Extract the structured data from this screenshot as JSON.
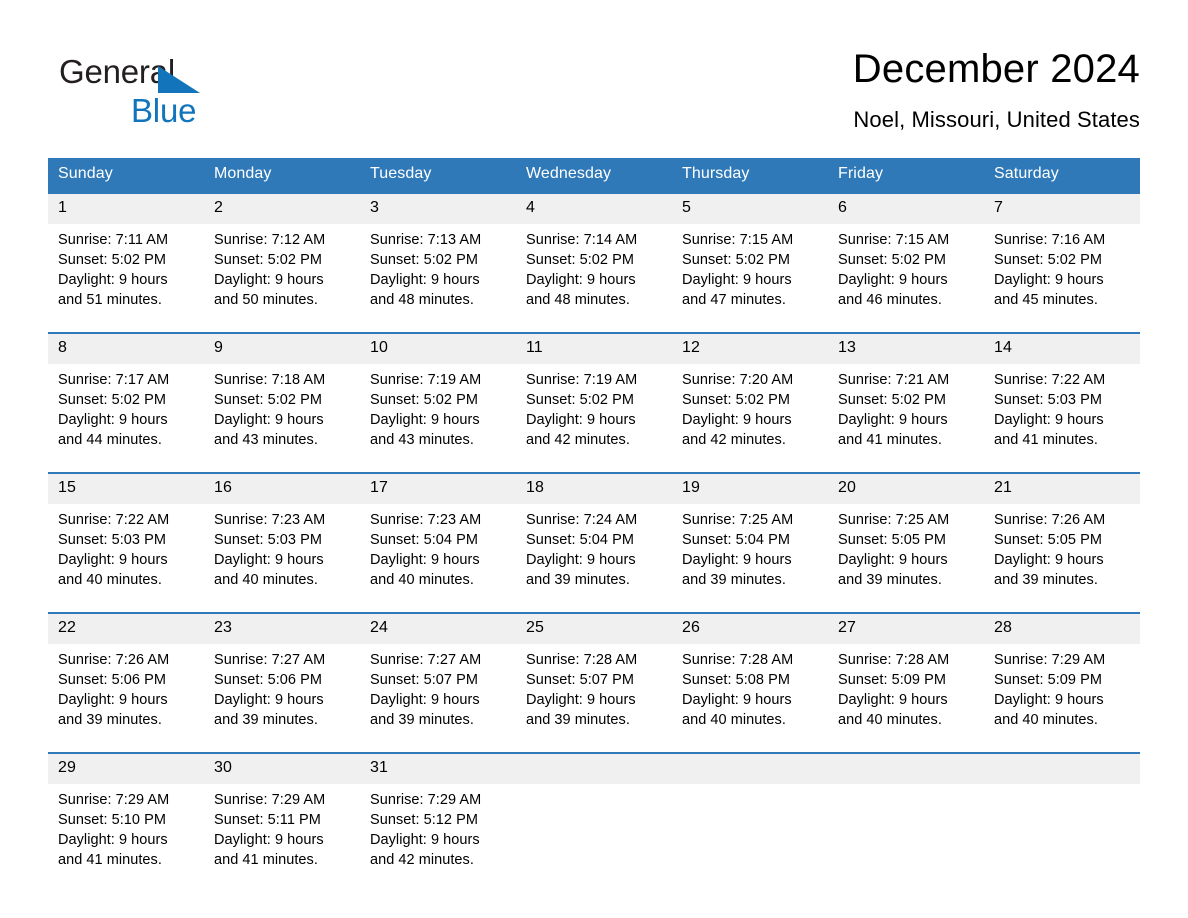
{
  "brand": {
    "name_part1": "General",
    "name_part2": "Blue",
    "accent_color": "#1275bc"
  },
  "header": {
    "title": "December 2024",
    "subtitle": "Noel, Missouri, United States"
  },
  "theme": {
    "header_blue": "#2f79b8",
    "daynum_band": "#f0f0f0",
    "cell_bg": "#ffffff"
  },
  "weekdays": [
    "Sunday",
    "Monday",
    "Tuesday",
    "Wednesday",
    "Thursday",
    "Friday",
    "Saturday"
  ],
  "weeks": [
    [
      {
        "day": "1",
        "l1": "Sunrise: 7:11 AM",
        "l2": "Sunset: 5:02 PM",
        "l3": "Daylight: 9 hours",
        "l4": "and 51 minutes."
      },
      {
        "day": "2",
        "l1": "Sunrise: 7:12 AM",
        "l2": "Sunset: 5:02 PM",
        "l3": "Daylight: 9 hours",
        "l4": "and 50 minutes."
      },
      {
        "day": "3",
        "l1": "Sunrise: 7:13 AM",
        "l2": "Sunset: 5:02 PM",
        "l3": "Daylight: 9 hours",
        "l4": "and 48 minutes."
      },
      {
        "day": "4",
        "l1": "Sunrise: 7:14 AM",
        "l2": "Sunset: 5:02 PM",
        "l3": "Daylight: 9 hours",
        "l4": "and 48 minutes."
      },
      {
        "day": "5",
        "l1": "Sunrise: 7:15 AM",
        "l2": "Sunset: 5:02 PM",
        "l3": "Daylight: 9 hours",
        "l4": "and 47 minutes."
      },
      {
        "day": "6",
        "l1": "Sunrise: 7:15 AM",
        "l2": "Sunset: 5:02 PM",
        "l3": "Daylight: 9 hours",
        "l4": "and 46 minutes."
      },
      {
        "day": "7",
        "l1": "Sunrise: 7:16 AM",
        "l2": "Sunset: 5:02 PM",
        "l3": "Daylight: 9 hours",
        "l4": "and 45 minutes."
      }
    ],
    [
      {
        "day": "8",
        "l1": "Sunrise: 7:17 AM",
        "l2": "Sunset: 5:02 PM",
        "l3": "Daylight: 9 hours",
        "l4": "and 44 minutes."
      },
      {
        "day": "9",
        "l1": "Sunrise: 7:18 AM",
        "l2": "Sunset: 5:02 PM",
        "l3": "Daylight: 9 hours",
        "l4": "and 43 minutes."
      },
      {
        "day": "10",
        "l1": "Sunrise: 7:19 AM",
        "l2": "Sunset: 5:02 PM",
        "l3": "Daylight: 9 hours",
        "l4": "and 43 minutes."
      },
      {
        "day": "11",
        "l1": "Sunrise: 7:19 AM",
        "l2": "Sunset: 5:02 PM",
        "l3": "Daylight: 9 hours",
        "l4": "and 42 minutes."
      },
      {
        "day": "12",
        "l1": "Sunrise: 7:20 AM",
        "l2": "Sunset: 5:02 PM",
        "l3": "Daylight: 9 hours",
        "l4": "and 42 minutes."
      },
      {
        "day": "13",
        "l1": "Sunrise: 7:21 AM",
        "l2": "Sunset: 5:02 PM",
        "l3": "Daylight: 9 hours",
        "l4": "and 41 minutes."
      },
      {
        "day": "14",
        "l1": "Sunrise: 7:22 AM",
        "l2": "Sunset: 5:03 PM",
        "l3": "Daylight: 9 hours",
        "l4": "and 41 minutes."
      }
    ],
    [
      {
        "day": "15",
        "l1": "Sunrise: 7:22 AM",
        "l2": "Sunset: 5:03 PM",
        "l3": "Daylight: 9 hours",
        "l4": "and 40 minutes."
      },
      {
        "day": "16",
        "l1": "Sunrise: 7:23 AM",
        "l2": "Sunset: 5:03 PM",
        "l3": "Daylight: 9 hours",
        "l4": "and 40 minutes."
      },
      {
        "day": "17",
        "l1": "Sunrise: 7:23 AM",
        "l2": "Sunset: 5:04 PM",
        "l3": "Daylight: 9 hours",
        "l4": "and 40 minutes."
      },
      {
        "day": "18",
        "l1": "Sunrise: 7:24 AM",
        "l2": "Sunset: 5:04 PM",
        "l3": "Daylight: 9 hours",
        "l4": "and 39 minutes."
      },
      {
        "day": "19",
        "l1": "Sunrise: 7:25 AM",
        "l2": "Sunset: 5:04 PM",
        "l3": "Daylight: 9 hours",
        "l4": "and 39 minutes."
      },
      {
        "day": "20",
        "l1": "Sunrise: 7:25 AM",
        "l2": "Sunset: 5:05 PM",
        "l3": "Daylight: 9 hours",
        "l4": "and 39 minutes."
      },
      {
        "day": "21",
        "l1": "Sunrise: 7:26 AM",
        "l2": "Sunset: 5:05 PM",
        "l3": "Daylight: 9 hours",
        "l4": "and 39 minutes."
      }
    ],
    [
      {
        "day": "22",
        "l1": "Sunrise: 7:26 AM",
        "l2": "Sunset: 5:06 PM",
        "l3": "Daylight: 9 hours",
        "l4": "and 39 minutes."
      },
      {
        "day": "23",
        "l1": "Sunrise: 7:27 AM",
        "l2": "Sunset: 5:06 PM",
        "l3": "Daylight: 9 hours",
        "l4": "and 39 minutes."
      },
      {
        "day": "24",
        "l1": "Sunrise: 7:27 AM",
        "l2": "Sunset: 5:07 PM",
        "l3": "Daylight: 9 hours",
        "l4": "and 39 minutes."
      },
      {
        "day": "25",
        "l1": "Sunrise: 7:28 AM",
        "l2": "Sunset: 5:07 PM",
        "l3": "Daylight: 9 hours",
        "l4": "and 39 minutes."
      },
      {
        "day": "26",
        "l1": "Sunrise: 7:28 AM",
        "l2": "Sunset: 5:08 PM",
        "l3": "Daylight: 9 hours",
        "l4": "and 40 minutes."
      },
      {
        "day": "27",
        "l1": "Sunrise: 7:28 AM",
        "l2": "Sunset: 5:09 PM",
        "l3": "Daylight: 9 hours",
        "l4": "and 40 minutes."
      },
      {
        "day": "28",
        "l1": "Sunrise: 7:29 AM",
        "l2": "Sunset: 5:09 PM",
        "l3": "Daylight: 9 hours",
        "l4": "and 40 minutes."
      }
    ],
    [
      {
        "day": "29",
        "l1": "Sunrise: 7:29 AM",
        "l2": "Sunset: 5:10 PM",
        "l3": "Daylight: 9 hours",
        "l4": "and 41 minutes."
      },
      {
        "day": "30",
        "l1": "Sunrise: 7:29 AM",
        "l2": "Sunset: 5:11 PM",
        "l3": "Daylight: 9 hours",
        "l4": "and 41 minutes."
      },
      {
        "day": "31",
        "l1": "Sunrise: 7:29 AM",
        "l2": "Sunset: 5:12 PM",
        "l3": "Daylight: 9 hours",
        "l4": "and 42 minutes."
      },
      {
        "day": "",
        "l1": "",
        "l2": "",
        "l3": "",
        "l4": ""
      },
      {
        "day": "",
        "l1": "",
        "l2": "",
        "l3": "",
        "l4": ""
      },
      {
        "day": "",
        "l1": "",
        "l2": "",
        "l3": "",
        "l4": ""
      },
      {
        "day": "",
        "l1": "",
        "l2": "",
        "l3": "",
        "l4": ""
      }
    ]
  ]
}
